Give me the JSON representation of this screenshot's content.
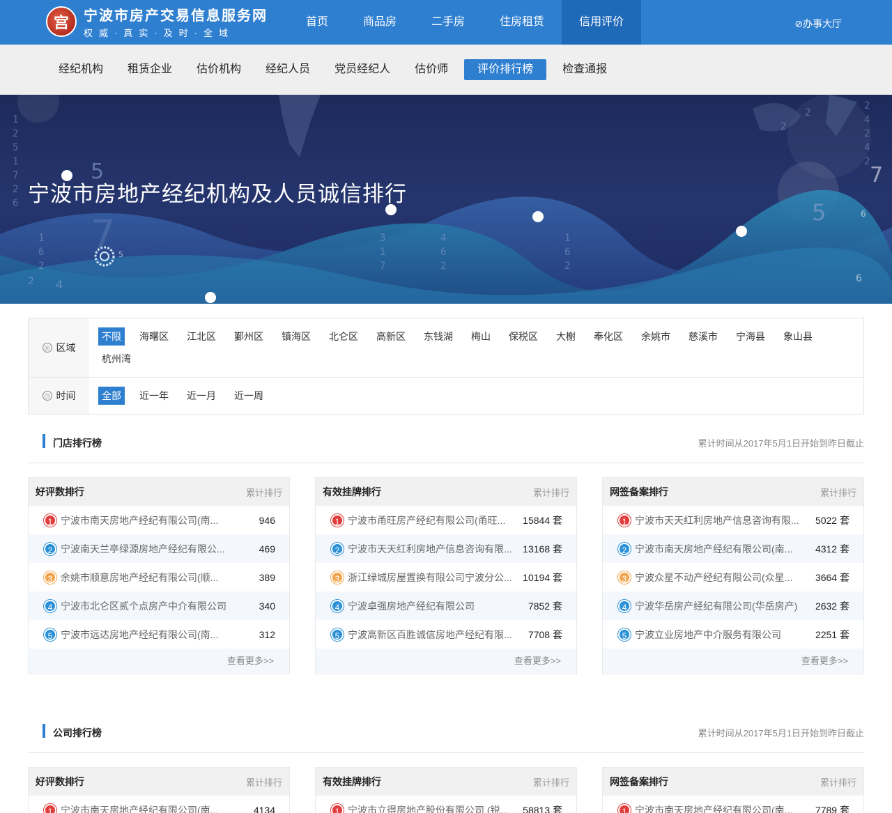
{
  "header": {
    "logo_char": "宫",
    "site_title": "宁波市房产交易信息服务网",
    "site_slogan": "权威·真实·及时·全域",
    "nav": [
      "首页",
      "商品房",
      "二手房",
      "住房租赁",
      "信用评价"
    ],
    "office_label": "⊘办事大厅"
  },
  "subnav": [
    "经纪机构",
    "租赁企业",
    "估价机构",
    "经纪人员",
    "党员经纪人",
    "估价师",
    "评价排行榜",
    "检查通报"
  ],
  "banner": {
    "title": "宁波市房地产经纪机构及人员诚信排行"
  },
  "filter": {
    "region_label": "区域",
    "regions": [
      "不限",
      "海曙区",
      "江北区",
      "鄞州区",
      "镇海区",
      "北仑区",
      "高新区",
      "东钱湖",
      "梅山",
      "保税区",
      "大榭",
      "奉化区",
      "余姚市",
      "慈溪市",
      "宁海县",
      "象山县",
      "杭州湾"
    ],
    "time_label": "时间",
    "times": [
      "全部",
      "近一年",
      "近一月",
      "近一周"
    ]
  },
  "store_section": {
    "title": "门店排行榜",
    "note": "累计时间从2017年5月1日开始到昨日截止",
    "boards": [
      {
        "title": "好评数排行",
        "sub": "累计排行",
        "rows": [
          {
            "name": "宁波市南天房地产经纪有限公司(南...",
            "value": "946"
          },
          {
            "name": "宁波南天兰亭绿源房地产经纪有限公...",
            "value": "469"
          },
          {
            "name": "余姚市顺意房地产经纪有限公司(顺...",
            "value": "389"
          },
          {
            "name": "宁波市北仑区贰个点房产中介有限公司",
            "value": "340"
          },
          {
            "name": "宁波市远达房地产经纪有限公司(南...",
            "value": "312"
          }
        ],
        "more": "查看更多>>"
      },
      {
        "title": "有效挂牌排行",
        "sub": "累计排行",
        "rows": [
          {
            "name": "宁波市甬旺房产经纪有限公司(甬旺...",
            "value": "15844 套"
          },
          {
            "name": "宁波市天天红利房地产信息咨询有限...",
            "value": "13168 套"
          },
          {
            "name": "浙江绿城房屋置换有限公司宁波分公...",
            "value": "10194 套"
          },
          {
            "name": "宁波卓强房地产经纪有限公司",
            "value": "7852 套"
          },
          {
            "name": "宁波高新区百胜诚信房地产经纪有限...",
            "value": "7708 套"
          }
        ],
        "more": "查看更多>>"
      },
      {
        "title": "网签备案排行",
        "sub": "累计排行",
        "rows": [
          {
            "name": "宁波市天天红利房地产信息咨询有限...",
            "value": "5022 套"
          },
          {
            "name": "宁波市南天房地产经纪有限公司(南...",
            "value": "4312 套"
          },
          {
            "name": "宁波众星不动产经纪有限公司(众星...",
            "value": "3664 套"
          },
          {
            "name": "宁波华岳房产经纪有限公司(华岳房产)",
            "value": "2632 套"
          },
          {
            "name": "宁波立业房地产中介服务有限公司",
            "value": "2251 套"
          }
        ],
        "more": "查看更多>>"
      }
    ]
  },
  "company_section": {
    "title": "公司排行榜",
    "note": "累计时间从2017年5月1日开始到昨日截止",
    "boards": [
      {
        "title": "好评数排行",
        "sub": "累计排行",
        "rows": [
          {
            "name": "宁波市南天房地产经纪有限公司(南...",
            "value": "4134"
          }
        ]
      },
      {
        "title": "有效挂牌排行",
        "sub": "累计排行",
        "rows": [
          {
            "name": "宁波市立得房地产股份有限公司 (锐...",
            "value": "58813 套"
          }
        ]
      },
      {
        "title": "网签备案排行",
        "sub": "累计排行",
        "rows": [
          {
            "name": "宁波市南天房地产经纪有限公司(南...",
            "value": "7789 套"
          }
        ]
      }
    ]
  },
  "colors": {
    "primary": "#2f7fd0",
    "rank1": "#e23c3c",
    "rank3": "#f2a44a",
    "rank_blue": "#2a90d8"
  }
}
